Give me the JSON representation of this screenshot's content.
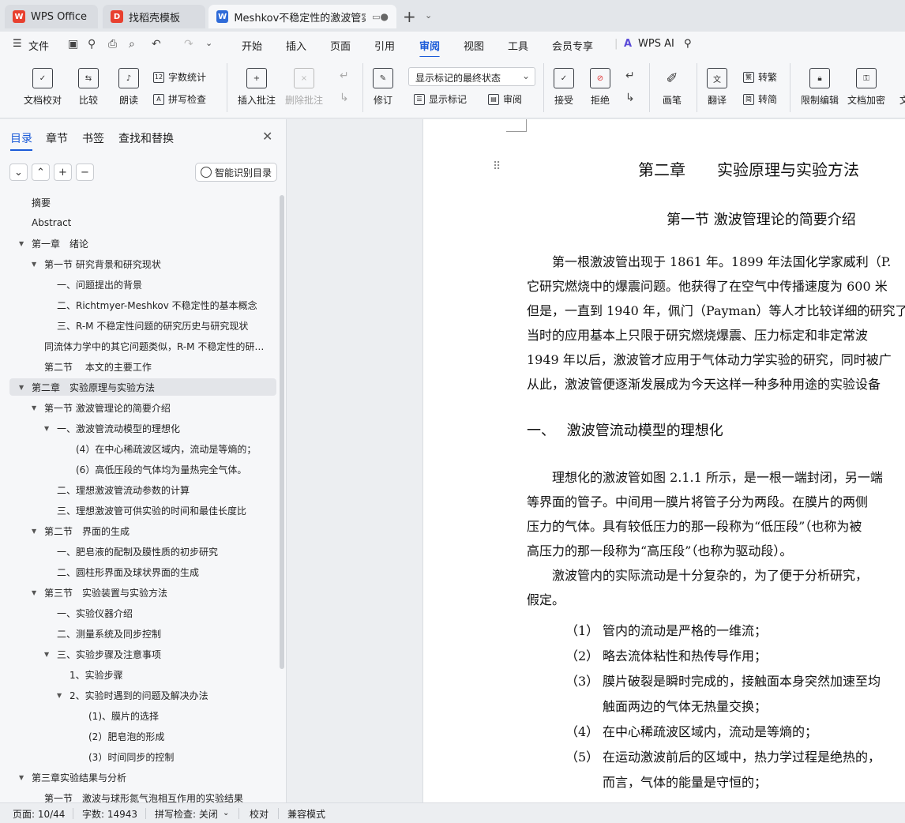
{
  "tabs": [
    {
      "label": "WPS Office",
      "logo": "W"
    },
    {
      "label": "找稻壳模板",
      "logo": "D"
    },
    {
      "label": "Meshkov不稳定性的激波管实",
      "logo": "W"
    }
  ],
  "menu": {
    "file": "文件",
    "items": [
      "开始",
      "插入",
      "页面",
      "引用",
      "审阅",
      "视图",
      "工具",
      "会员专享"
    ],
    "active": "审阅",
    "wps_ai": "WPS AI"
  },
  "ribbon": {
    "doc_check": "文档校对",
    "compare": "比较",
    "read_aloud": "朗读",
    "word_count": "字数统计",
    "spell_check": "拼写检查",
    "insert_comment": "插入批注",
    "delete_comment": "删除批注",
    "track": "修订",
    "markup_state": "显示标记的最终状态",
    "show_markup": "显示标记",
    "review": "审阅",
    "accept": "接受",
    "reject": "拒绝",
    "pen": "画笔",
    "translate": "翻译",
    "to_trad": "转繁",
    "to_simp": "转简",
    "restrict": "限制编辑",
    "encrypt": "文档加密",
    "more": "文"
  },
  "sidebar": {
    "tabs": [
      "目录",
      "章节",
      "书签",
      "查找和替换"
    ],
    "smart_toc": "智能识别目录",
    "toc": [
      {
        "text": "摘要",
        "level": 0,
        "tri": ""
      },
      {
        "text": "Abstract",
        "level": 0,
        "tri": ""
      },
      {
        "text": "第一章　绪论",
        "level": 0,
        "tri": "▼"
      },
      {
        "text": "第一节  研究背景和研究现状",
        "level": 1,
        "tri": "▼"
      },
      {
        "text": "一、问题提出的背景",
        "level": 2,
        "tri": ""
      },
      {
        "text": "二、Richtmyer-Meshkov 不稳定性的基本概念",
        "level": 2,
        "tri": ""
      },
      {
        "text": "三、R-M 不稳定性问题的研究历史与研究现状",
        "level": 2,
        "tri": ""
      },
      {
        "text": "同流体力学中的其它问题类似，R-M 不稳定性的研…",
        "level": 1,
        "tri": ""
      },
      {
        "text": "第二节　 本文的主要工作",
        "level": 1,
        "tri": ""
      },
      {
        "text": "第二章　实验原理与实验方法",
        "level": 0,
        "tri": "▼",
        "selected": true
      },
      {
        "text": "第一节  激波管理论的简要介绍",
        "level": 1,
        "tri": "▼"
      },
      {
        "text": "一、激波管流动模型的理想化",
        "level": 2,
        "tri": "▼"
      },
      {
        "text": "(4）在中心稀疏波区域内，流动是等熵的；",
        "level": 4,
        "tri": ""
      },
      {
        "text": "(6）高低压段的气体均为量热完全气体。",
        "level": 4,
        "tri": ""
      },
      {
        "text": "二、理想激波管流动参数的计算",
        "level": 2,
        "tri": ""
      },
      {
        "text": "三、理想激波管可供实验的时间和最佳长度比",
        "level": 2,
        "tri": ""
      },
      {
        "text": "第二节　界面的生成",
        "level": 1,
        "tri": "▼"
      },
      {
        "text": "一、肥皂液的配制及膜性质的初步研究",
        "level": 2,
        "tri": ""
      },
      {
        "text": "二、圆柱形界面及球状界面的生成",
        "level": 2,
        "tri": ""
      },
      {
        "text": "第三节　实验装置与实验方法",
        "level": 1,
        "tri": "▼"
      },
      {
        "text": "一、实验仪器介绍",
        "level": 2,
        "tri": ""
      },
      {
        "text": "二、测量系统及同步控制",
        "level": 2,
        "tri": ""
      },
      {
        "text": "三、实验步骤及注意事项",
        "level": 2,
        "tri": "▼"
      },
      {
        "text": "1、实验步骤",
        "level": 3,
        "tri": ""
      },
      {
        "text": "2、实验时遇到的问题及解决办法",
        "level": 3,
        "tri": "▼"
      },
      {
        "text": "(1)、膜片的选择",
        "level": 5,
        "tri": ""
      },
      {
        "text": "(2）肥皂泡的形成",
        "level": 5,
        "tri": ""
      },
      {
        "text": "(3）时间同步的控制",
        "level": 5,
        "tri": ""
      },
      {
        "text": "第三章实验结果与分析",
        "level": 0,
        "tri": "▼"
      },
      {
        "text": "第一节　激波与球形氮气泡相互作用的实验结果",
        "level": 1,
        "tri": ""
      }
    ]
  },
  "document": {
    "chapter": "第二章　　实验原理与实验方法",
    "section": "第一节  激波管理论的简要介绍",
    "lines": [
      "　　第一根激波管出现于 1861 年。1899 年法国化学家威利（P.",
      "它研究燃烧中的爆震问题。他获得了在空气中传播速度为 600 米",
      "但是，一直到 1940 年，佩门（Payman）等人才比较详细的研究了",
      "当时的应用基本上只限于研究燃烧爆震、压力标定和非定常波",
      "1949 年以后，激波管才应用于气体动力学实验的研究，同时被广",
      "从此，激波管便逐渐发展成为今天这样一种多种用途的实验设备"
    ],
    "heading3": "一、　 激波管流动模型的理想化",
    "lines2": [
      "　　理想化的激波管如图 2.1.1 所示，是一根一端封闭，另一端",
      "等界面的管子。中间用一膜片将管子分为两段。在膜片的两侧",
      "压力的气体。具有较低压力的那一段称为“低压段”（也称为被",
      "高压力的那一段称为“高压段”（也称为驱动段）。",
      "　　激波管内的实际流动是十分复杂的，为了便于分析研究，",
      "假定。"
    ],
    "list": [
      {
        "num": "（1）",
        "text": "管内的流动是严格的一维流；"
      },
      {
        "num": "（2）",
        "text": "略去流体粘性和热传导作用；"
      },
      {
        "num": "（3）",
        "text": "膜片破裂是瞬时完成的，接触面本身突然加速至均"
      },
      {
        "num": "",
        "text": "触面两边的气体无热量交换；"
      },
      {
        "num": "（4）",
        "text": "在中心稀疏波区域内，流动是等熵的；"
      },
      {
        "num": "（5）",
        "text": "在运动激波前后的区域中，热力学过程是绝热的，"
      },
      {
        "num": "",
        "text": "而言，气体的能量是守恒的；"
      }
    ]
  },
  "status": {
    "page": "页面: 10/44",
    "words": "字数: 14943",
    "spell": "拼写检查: 关闭",
    "proof": "校对",
    "compat": "兼容模式"
  },
  "colors": {
    "accent": "#1b5bd8",
    "wps_red": "#e8402f",
    "doc_blue": "#2f6bd8"
  }
}
